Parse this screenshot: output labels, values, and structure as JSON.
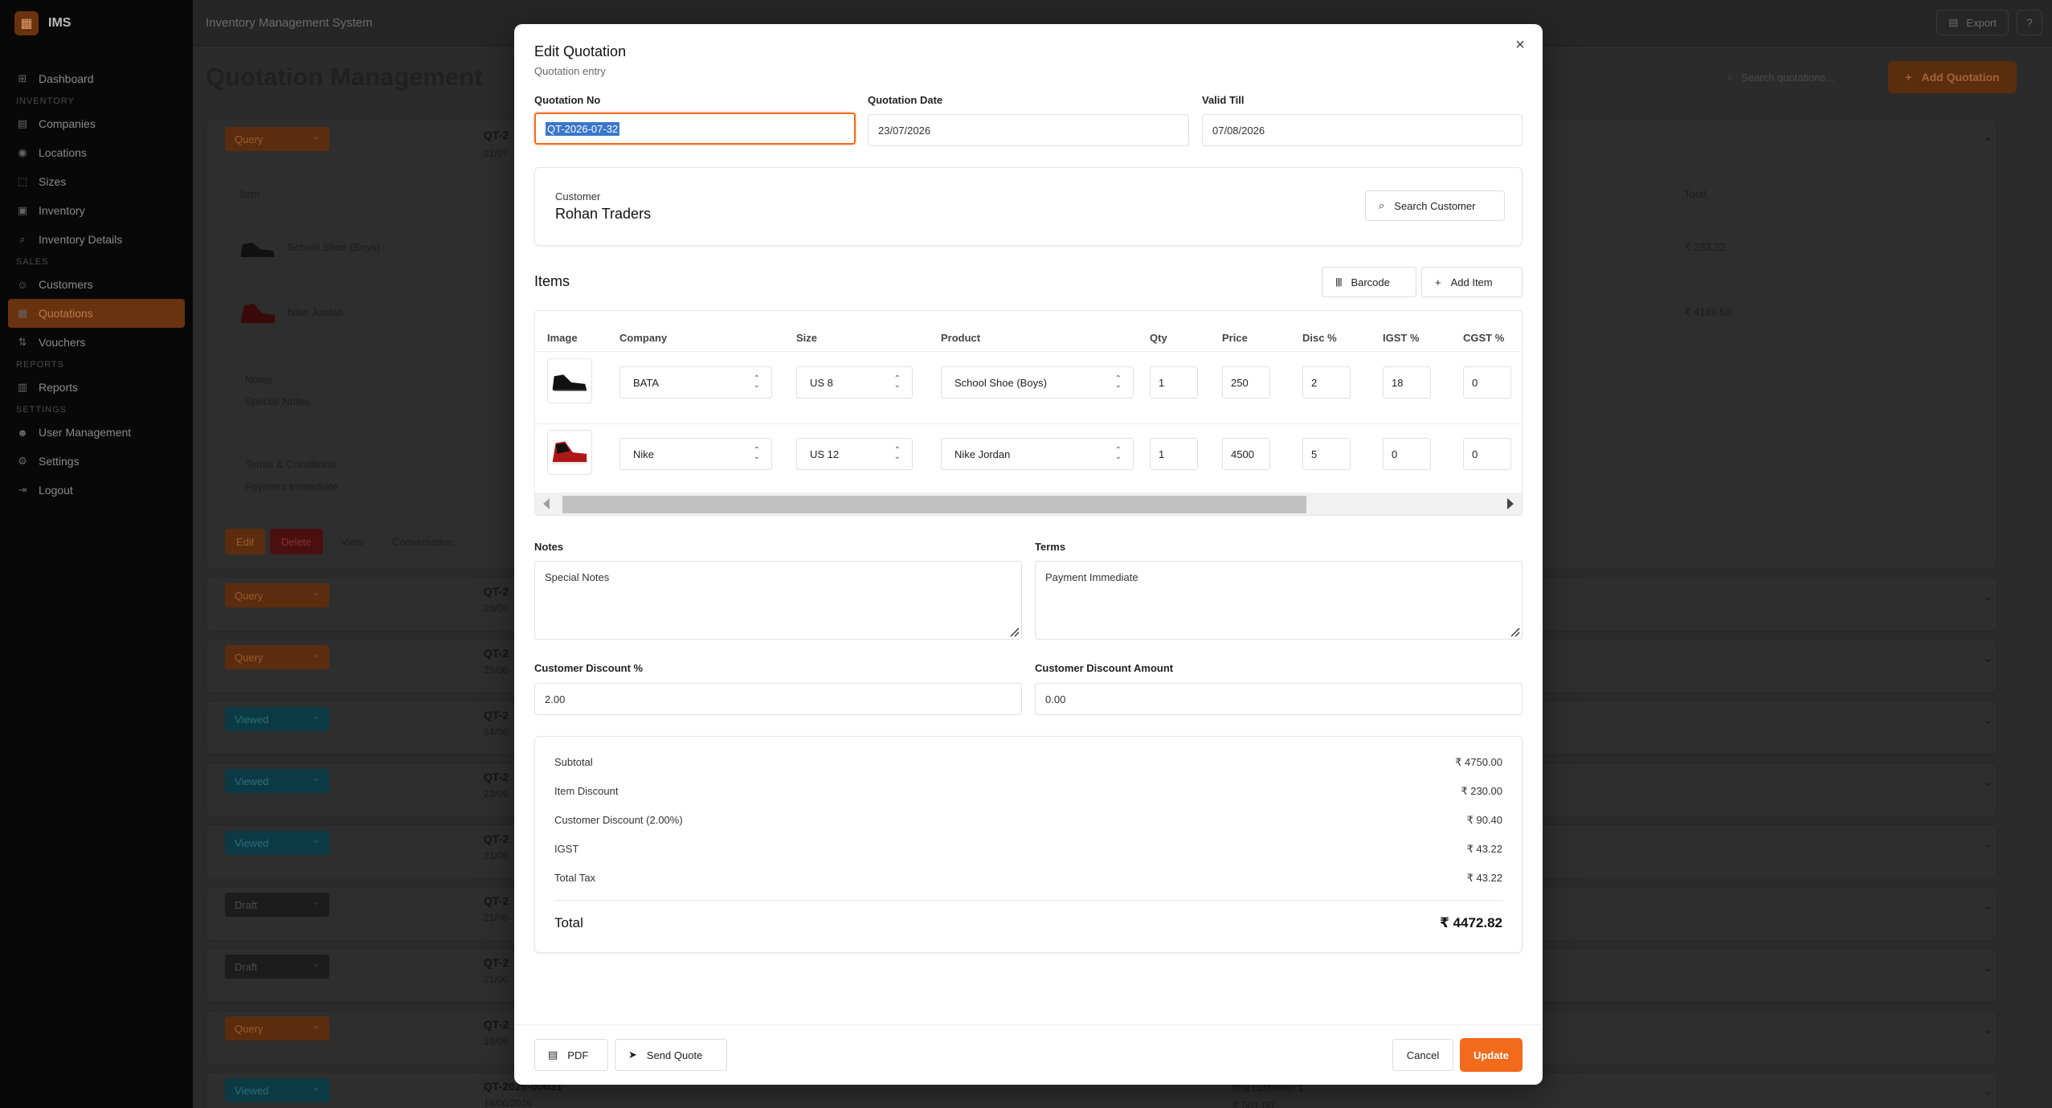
{
  "app": {
    "name": "IMS",
    "topbar_title": "Inventory Management System",
    "export_label": "Export",
    "help_glyph": "?"
  },
  "sidebar": {
    "items": [
      {
        "type": "item",
        "label": "Dashboard",
        "icon": "⊞"
      },
      {
        "type": "section",
        "label": "INVENTORY"
      },
      {
        "type": "item",
        "label": "Companies",
        "icon": "▤"
      },
      {
        "type": "item",
        "label": "Locations",
        "icon": "◉"
      },
      {
        "type": "item",
        "label": "Sizes",
        "icon": "⬚"
      },
      {
        "type": "item",
        "label": "Inventory",
        "icon": "▣"
      },
      {
        "type": "item",
        "label": "Inventory Details",
        "icon": "⌕"
      },
      {
        "type": "section",
        "label": "SALES"
      },
      {
        "type": "item",
        "label": "Customers",
        "icon": "☺"
      },
      {
        "type": "item",
        "label": "Quotations",
        "icon": "▦",
        "active": true
      },
      {
        "type": "item",
        "label": "Vouchers",
        "icon": "⇅"
      },
      {
        "type": "section",
        "label": "REPORTS"
      },
      {
        "type": "item",
        "label": "Reports",
        "icon": "▥"
      },
      {
        "type": "section",
        "label": "SETTINGS"
      },
      {
        "type": "item",
        "label": "User Management",
        "icon": "☻"
      },
      {
        "type": "item",
        "label": "Settings",
        "icon": "⚙"
      },
      {
        "type": "item",
        "label": "Logout",
        "icon": "⇥"
      }
    ]
  },
  "page": {
    "title": "Quotation Management",
    "search_placeholder": "Search quotations...",
    "add_label": "Add Quotation"
  },
  "background": {
    "expanded": {
      "status": "Query",
      "qno": "QT-2",
      "date": "21/07",
      "col_item": "Item",
      "col_total": "Total",
      "items": [
        {
          "name": "School Shoe (Boys)",
          "total": "₹ 283.32"
        },
        {
          "name": "Nike Jordan",
          "total": "₹ 4189.50"
        }
      ],
      "notes_label": "Notes",
      "notes_value": "Special Notes",
      "terms_label": "Terms & Conditions",
      "terms_value": "Payment Immediate",
      "actions": {
        "edit": "Edit",
        "delete": "Delete",
        "view": "View",
        "conversation": "Conversation"
      }
    },
    "rows": [
      {
        "status": "Query",
        "qno": "QT-2",
        "date": "26/06"
      },
      {
        "status": "Query",
        "qno": "QT-2",
        "date": "25/06"
      },
      {
        "status": "Viewed",
        "qno": "QT-2",
        "date": "24/06"
      },
      {
        "status": "Viewed",
        "qno": "QT-2",
        "date": "23/06"
      },
      {
        "status": "Viewed",
        "qno": "QT-2",
        "date": "21/06"
      },
      {
        "status": "Draft",
        "qno": "QT-2",
        "date": "21/06"
      },
      {
        "status": "Draft",
        "qno": "QT-2",
        "date": "21/06"
      },
      {
        "status": "Query",
        "qno": "QT-2",
        "date": "18/06"
      },
      {
        "status": "Viewed",
        "qno": "QT-2026-00031",
        "date": "18/06/2026",
        "customer": "test customer 1",
        "amount": "₹ 501.00"
      }
    ]
  },
  "modal": {
    "title": "Edit Quotation",
    "subtitle": "Quotation entry",
    "close_glyph": "×",
    "fields": {
      "quotation_no_label": "Quotation No",
      "quotation_no_value": "QT-2026-07-32",
      "quotation_date_label": "Quotation Date",
      "quotation_date_value": "23/07/2026",
      "valid_till_label": "Valid Till",
      "valid_till_value": "07/08/2026"
    },
    "customer": {
      "label": "Customer",
      "name": "Rohan Traders",
      "search_label": "Search Customer"
    },
    "items_title": "Items",
    "barcode_label": "Barcode",
    "add_item_label": "Add Item",
    "table": {
      "headers": [
        "Image",
        "Company",
        "Size",
        "Product",
        "Qty",
        "Price",
        "Disc %",
        "IGST %",
        "CGST %"
      ],
      "rows": [
        {
          "company": "BATA",
          "size": "US 8",
          "product": "School Shoe (Boys)",
          "qty": "1",
          "price": "250",
          "disc": "2",
          "igst": "18",
          "cgst": "0"
        },
        {
          "company": "Nike",
          "size": "US 12",
          "product": "Nike Jordan",
          "qty": "1",
          "price": "4500",
          "disc": "5",
          "igst": "0",
          "cgst": "0"
        }
      ]
    },
    "notes_label": "Notes",
    "notes_value": "Special Notes",
    "terms_label": "Terms",
    "terms_value": "Payment Immediate",
    "cust_disc_pct_label": "Customer Discount %",
    "cust_disc_pct_value": "2.00",
    "cust_disc_amt_label": "Customer Discount Amount",
    "cust_disc_amt_value": "0.00",
    "summary": {
      "rows": [
        {
          "label": "Subtotal",
          "value": "₹ 4750.00"
        },
        {
          "label": "Item Discount",
          "value": "₹ 230.00"
        },
        {
          "label": "Customer Discount (2.00%)",
          "value": "₹ 90.40"
        },
        {
          "label": "IGST",
          "value": "₹ 43.22"
        },
        {
          "label": "Total Tax",
          "value": "₹ 43.22"
        }
      ],
      "total_label": "Total",
      "total_value": "₹ 4472.82"
    },
    "footer": {
      "pdf_label": "PDF",
      "send_label": "Send Quote",
      "cancel_label": "Cancel",
      "update_label": "Update"
    },
    "colors": {
      "accent": "#f26a1b",
      "selection": "#3a77c9"
    }
  }
}
